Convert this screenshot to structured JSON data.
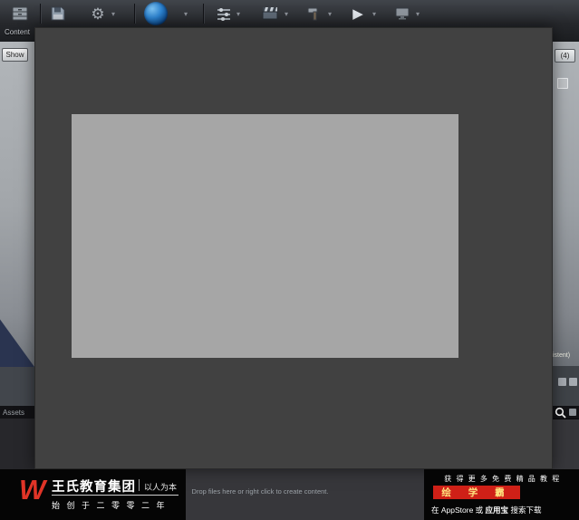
{
  "icons": {
    "caret": "▾",
    "gear": "⚙",
    "play": "▶",
    "search": "svg-magnifier",
    "content_browser": "svg-drawer",
    "save": "svg-floppy",
    "marketplace": "svg-globe",
    "settings": "svg-sliders",
    "cinematics": "svg-clapperboard",
    "build": "svg-hammer",
    "launch": "svg-monitor"
  },
  "toolbar": {
    "content_label": "Content"
  },
  "viewport": {
    "show_label": "Show",
    "count_badge": "(4)",
    "level_label_partial": "istent)"
  },
  "content_browser": {
    "assets_label": "Assets",
    "drop_hint": "Drop files here or right click to create content."
  },
  "banner": {
    "logo_letter": "W",
    "company": "王氏教育集团",
    "slogan": "以人为本",
    "founded": "始 创 于 二 零 零 二 年",
    "promo_line1": "获 得 更 多 免 费 精 品 教 程",
    "brand": "绘 学 霸",
    "promo_line2_prefix": "在 AppStore 或",
    "promo_line2_app": "应用宝",
    "promo_line2_suffix": "搜索下载"
  },
  "colors": {
    "brand_red": "#cf2017",
    "brand_gold": "#ffe57f",
    "marketplace_blue": "#2e84d0"
  }
}
